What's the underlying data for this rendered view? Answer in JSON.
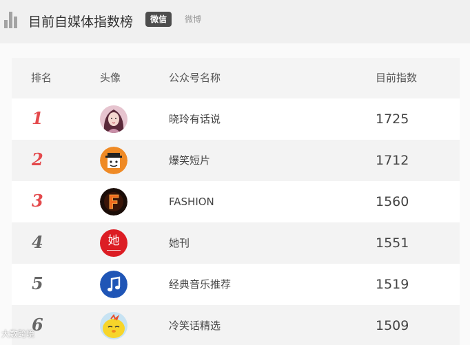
{
  "header": {
    "title": "目前自媒体指数榜",
    "tab_active": "微信",
    "tab_inactive": "微博"
  },
  "table": {
    "columns": [
      "排名",
      "头像",
      "公众号名称",
      "目前指数"
    ],
    "rows": [
      {
        "rank": "1",
        "name": "晓玲有话说",
        "score": "1725",
        "avatar_icon": "woman-portrait-icon"
      },
      {
        "rank": "2",
        "name": "爆笑短片",
        "score": "1712",
        "avatar_icon": "cartoon-face-icon"
      },
      {
        "rank": "3",
        "name": "FASHION",
        "score": "1560",
        "avatar_icon": "flame-letter-f-icon"
      },
      {
        "rank": "4",
        "name": "她刊",
        "score": "1551",
        "avatar_icon": "taken-logo-icon",
        "avatar_text": "她"
      },
      {
        "rank": "5",
        "name": "经典音乐推荐",
        "score": "1519",
        "avatar_icon": "music-note-icon"
      },
      {
        "rank": "6",
        "name": "冷笑话精选",
        "score": "1509",
        "avatar_icon": "yellow-chick-icon"
      }
    ]
  },
  "watermark": "大数跨境",
  "colors": {
    "rank_hot": "#e4494c",
    "rank_cold": "#666666",
    "tab_active_bg": "#4d4d4d"
  }
}
